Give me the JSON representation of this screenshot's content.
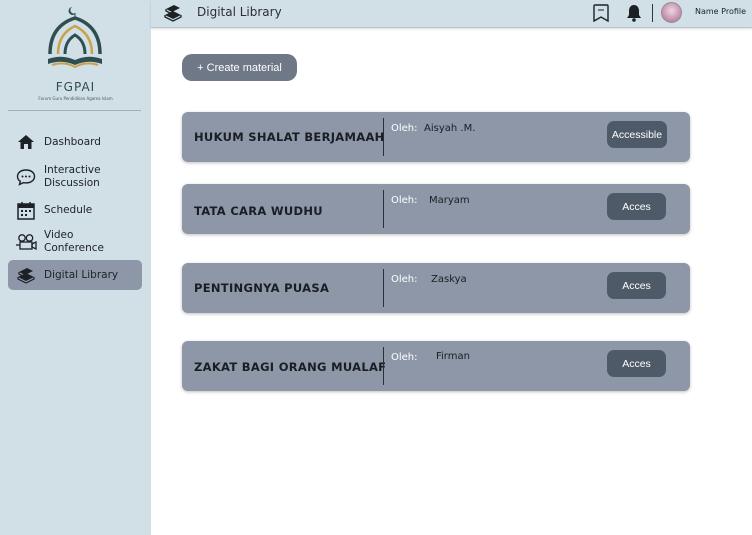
{
  "brand": {
    "name": "FGPAI",
    "tagline": "Forum Guru Pendidikan Agama Islam"
  },
  "nav": {
    "items": [
      {
        "label": "Dashboard",
        "icon": "home-icon"
      },
      {
        "label": "Interactive Discussion",
        "icon": "chat-icon"
      },
      {
        "label": "Schedule",
        "icon": "calendar-icon"
      },
      {
        "label": "Video Conference",
        "icon": "video-icon"
      },
      {
        "label": "Digital Library",
        "icon": "book-icon",
        "active": true
      }
    ]
  },
  "topbar": {
    "title": "Digital Library",
    "profile_name": "Name Profile"
  },
  "actions": {
    "create_label": "+ Create material"
  },
  "materials": [
    {
      "title": "HUKUM SHALAT BERJAMAAH",
      "by_label": "Oleh:",
      "author": "Aisyah .M.",
      "button": "Accessible"
    },
    {
      "title": "TATA CARA WUDHU",
      "by_label": "Oleh:",
      "author": "Maryam",
      "button": "Acces"
    },
    {
      "title": "PENTINGNYA PUASA",
      "by_label": "Oleh:",
      "author": "Zaskya",
      "button": "Acces"
    },
    {
      "title": "ZAKAT BAGI ORANG MUALAF",
      "by_label": "Oleh:",
      "author": "Firman",
      "button": "Acces"
    }
  ],
  "colors": {
    "sidebar_bg": "#d1dfe6",
    "card_bg": "#8d97a8",
    "button_bg": "#4f5a69",
    "create_bg": "#6f7886",
    "logo_green": "#2e4e50",
    "logo_gold": "#c9a24a"
  }
}
